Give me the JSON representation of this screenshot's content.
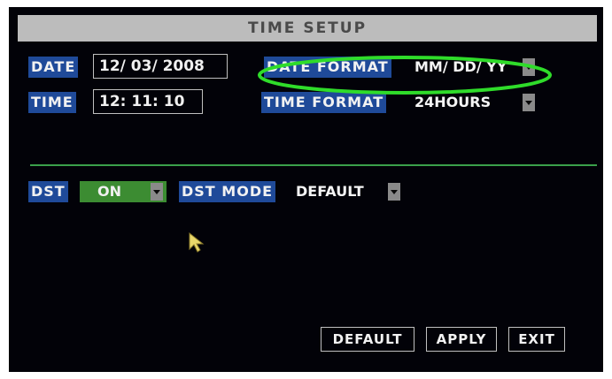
{
  "title": "TIME SETUP",
  "date": {
    "label": "DATE",
    "value": "12/ 03/ 2008"
  },
  "time": {
    "label": "TIME",
    "value": "12: 11: 10"
  },
  "date_format": {
    "label": "DATE FORMAT",
    "value": "MM/ DD/ YY"
  },
  "time_format": {
    "label": "TIME FORMAT",
    "value": "24HOURS"
  },
  "dst": {
    "label": "DST",
    "value": "ON"
  },
  "dst_mode": {
    "label": "DST MODE",
    "value": "DEFAULT"
  },
  "buttons": {
    "default": "DEFAULT",
    "apply": "APPLY",
    "exit": "EXIT"
  },
  "icons": {
    "dropdown": "chevron-down-icon",
    "cursor": "mouse-pointer-icon"
  },
  "colors": {
    "background": "#020208",
    "title_bar": "#bcbcbc",
    "label_bg": "#1f4a99",
    "divider": "#3aa04a",
    "dst_on_bg": "#3c8c32",
    "highlight_ring": "#2fdc2a"
  }
}
